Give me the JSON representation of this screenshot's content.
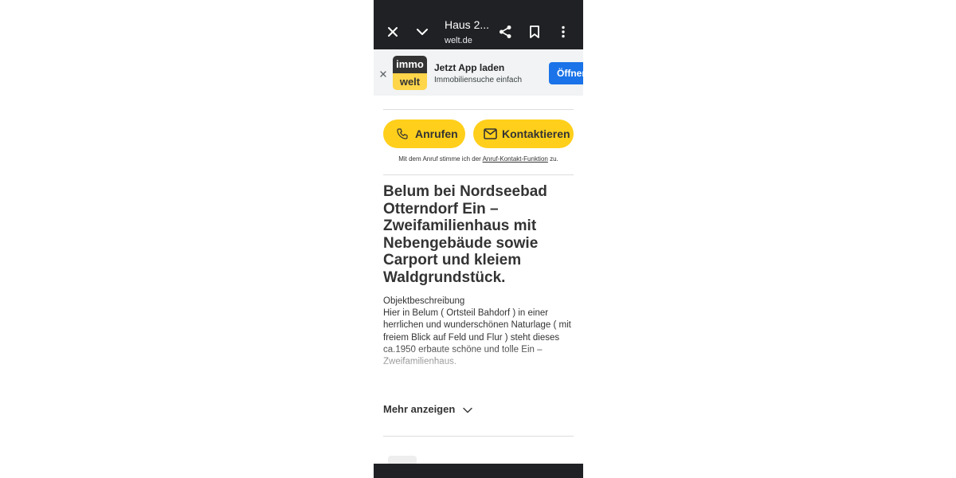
{
  "browser": {
    "title": "Haus 2...",
    "url": "welt.de"
  },
  "app_banner": {
    "logo_top": "immo",
    "logo_bottom": "welt",
    "title": "Jetzt App laden",
    "subtitle": "Immobiliensuche einfach",
    "open_label": "Öffnen"
  },
  "actions": {
    "call_label": "Anrufen",
    "contact_label": "Kontaktieren",
    "consent_prefix": "Mit dem Anruf stimme ich der ",
    "consent_link": "Anruf-Kontakt-Funktion",
    "consent_suffix": " zu."
  },
  "listing": {
    "headline": "Belum bei Nordseebad Otterndorf Ein – Zweifamilienhaus mit Nebengebäude sowie Carport und kleiem Waldgrundstück.",
    "description_heading": "Objektbeschreibung",
    "description": "Hier in Belum ( Ortsteil Bahdorf ) in einer herrlichen und wunderschönen Naturlage ( mit freiem Blick auf Feld und Flur ) steht dieses ca.1950 erbaute schöne und tolle Ein – Zweifamilienhaus.",
    "more_label": "Mehr anzeigen"
  },
  "colors": {
    "toolbar": "#202124",
    "accent_yellow": "#ffcf1b",
    "open_button_blue": "#1a73e8",
    "text": "#333333"
  },
  "icons": [
    "close-icon",
    "chevron-down-icon",
    "share-icon",
    "bookmark-icon",
    "more-vert-icon",
    "phone-icon",
    "mail-icon"
  ]
}
